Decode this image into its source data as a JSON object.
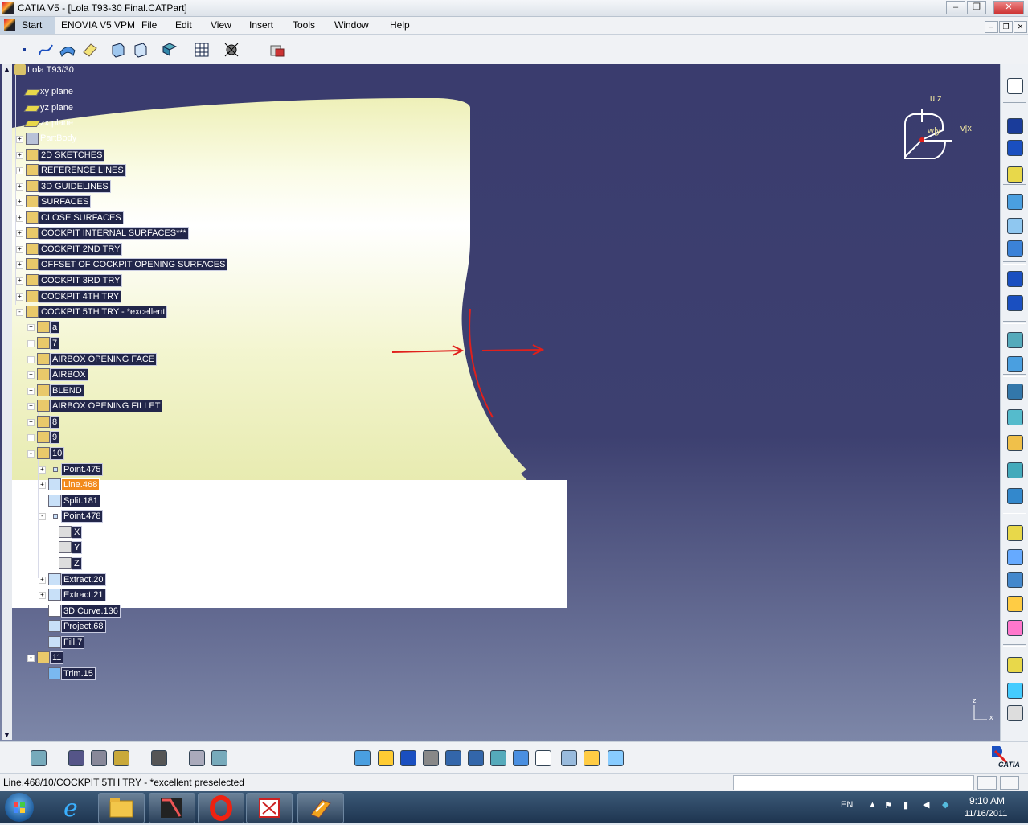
{
  "window": {
    "title": "CATIA V5 - [Lola T93-30 Final.CATPart]",
    "controls": [
      "–",
      "❐",
      "✕"
    ],
    "mdi_controls": [
      "–",
      "❐",
      "✕"
    ]
  },
  "menu": {
    "items": [
      "Start",
      "ENOVIA V5 VPM",
      "File",
      "Edit",
      "View",
      "Insert",
      "Tools",
      "Window",
      "Help"
    ]
  },
  "tree": {
    "root": "Lola T93/30",
    "nodes": [
      {
        "label": "xy plane",
        "icon": "plane-icon"
      },
      {
        "label": "yz plane",
        "icon": "plane-icon"
      },
      {
        "label": "zx plane",
        "icon": "plane-icon"
      },
      {
        "label": "PartBody",
        "icon": "body-icon"
      },
      {
        "label": "2D SKETCHES",
        "icon": "geometrical-set-icon"
      },
      {
        "label": "REFERENCE LINES",
        "icon": "geometrical-set-icon"
      },
      {
        "label": "3D GUIDELINES",
        "icon": "geometrical-set-icon"
      },
      {
        "label": "SURFACES",
        "icon": "geometrical-set-icon"
      },
      {
        "label": "CLOSE SURFACES",
        "icon": "geometrical-set-icon"
      },
      {
        "label": "COCKPIT INTERNAL SURFACES***",
        "icon": "geometrical-set-icon"
      },
      {
        "label": "COCKPIT 2ND TRY",
        "icon": "geometrical-set-icon"
      },
      {
        "label": "OFFSET OF COCKPIT OPENING SURFACES",
        "icon": "geometrical-set-icon"
      },
      {
        "label": "COCKPIT 3RD TRY",
        "icon": "geometrical-set-icon"
      },
      {
        "label": "COCKPIT 4TH TRY",
        "icon": "geometrical-set-icon"
      },
      {
        "label": "COCKPIT 5TH TRY - *excellent",
        "icon": "geometrical-set-icon"
      },
      {
        "label": "a",
        "icon": "geometrical-set-icon"
      },
      {
        "label": "7",
        "icon": "geometrical-set-icon"
      },
      {
        "label": "AIRBOX OPENING FACE",
        "icon": "geometrical-set-icon"
      },
      {
        "label": "AIRBOX",
        "icon": "geometrical-set-icon"
      },
      {
        "label": "BLEND",
        "icon": "geometrical-set-icon"
      },
      {
        "label": "AIRBOX OPENING FILLET",
        "icon": "geometrical-set-icon"
      },
      {
        "label": "8",
        "icon": "geometrical-set-icon"
      },
      {
        "label": "9",
        "icon": "geometrical-set-icon"
      },
      {
        "label": "10",
        "icon": "geometrical-set-icon"
      },
      {
        "label": "Point.475",
        "icon": "point-icon"
      },
      {
        "label": "Line.468",
        "icon": "line-icon"
      },
      {
        "label": "Split.181",
        "icon": "split-icon"
      },
      {
        "label": "Point.478",
        "icon": "point-icon"
      },
      {
        "label": "X",
        "icon": "parameter-icon"
      },
      {
        "label": "Y",
        "icon": "parameter-icon"
      },
      {
        "label": "Z",
        "icon": "parameter-icon"
      },
      {
        "label": "Extract.20",
        "icon": "extract-icon"
      },
      {
        "label": "Extract.21",
        "icon": "extract-icon"
      },
      {
        "label": "3D Curve.136",
        "icon": "curve-icon"
      },
      {
        "label": "Project.68",
        "icon": "project-icon"
      },
      {
        "label": "Fill.7",
        "icon": "fill-icon"
      },
      {
        "label": "11",
        "icon": "geometrical-set-icon"
      },
      {
        "label": "Trim.15",
        "icon": "trim-icon"
      }
    ]
  },
  "compass": {
    "u_label": "u|z",
    "v_label": "v|x",
    "w_label": "w|y"
  },
  "axis_triad": {
    "z": "z",
    "x": "x"
  },
  "status": {
    "message": "Line.468/10/COCKPIT 5TH TRY - *excellent preselected"
  },
  "logo": {
    "text": "CATIA"
  },
  "taskbar": {
    "language": "EN",
    "time": "9:10 AM",
    "date": "11/16/2011"
  },
  "colors": {
    "viewport_top": "#3a3c6e",
    "surface": "#f4f6d2",
    "selection": "#f28a1c",
    "annotation": "#e0201c"
  }
}
